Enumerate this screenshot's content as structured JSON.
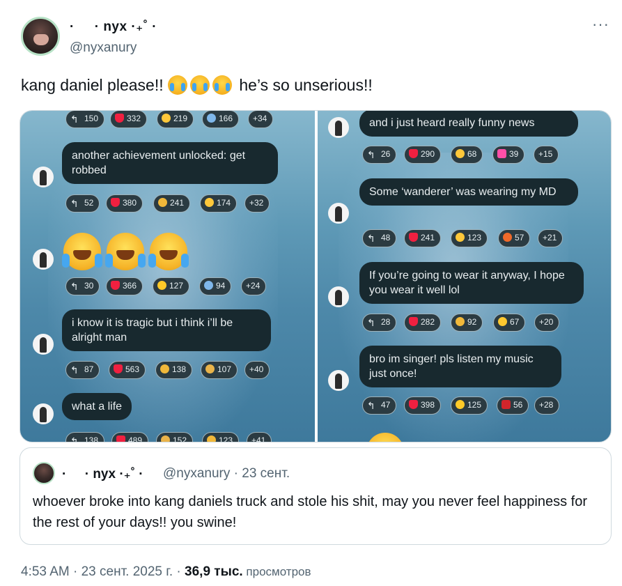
{
  "author": {
    "display_name": "·     · nyx ·₊˚ ·",
    "handle": "@nyxanury"
  },
  "tweet": {
    "text_before": "kang daniel please!! ",
    "text_after": " he’s so unserious!!",
    "emoji_name": "loudly-crying-face"
  },
  "media": {
    "left": {
      "messages": [
        {
          "text": "another achievement unlocked: get robbed"
        },
        {
          "text": "i know it is tragic but i think i’ll be alright man"
        },
        {
          "text": "what a life"
        }
      ],
      "reaction_rows": [
        [
          "150",
          "332",
          "219",
          "166",
          "+34"
        ],
        [
          "52",
          "380",
          "241",
          "174",
          "+32"
        ],
        [
          "30",
          "366",
          "127",
          "94",
          "+24"
        ],
        [
          "87",
          "563",
          "138",
          "107",
          "+40"
        ],
        [
          "138",
          "489",
          "152",
          "123",
          "+41"
        ]
      ]
    },
    "right": {
      "messages": [
        {
          "text": "and i just heard really funny news"
        },
        {
          "text": "Some ‘wanderer’ was wearing my MD"
        },
        {
          "text": "If you’re going to wear it anyway, I hope you wear it well lol"
        },
        {
          "text": "bro im singer! pls listen my music just once!"
        }
      ],
      "reaction_rows": [
        [
          "26",
          "290",
          "68",
          "39",
          "+15"
        ],
        [
          "48",
          "241",
          "123",
          "57",
          "+21"
        ],
        [
          "28",
          "282",
          "92",
          "67",
          "+20"
        ],
        [
          "47",
          "398",
          "125",
          "56",
          "+28"
        ]
      ]
    }
  },
  "quote": {
    "display_name": "·     · nyx ·₊˚ ·",
    "meta": "@nyxanury · 23 сент.",
    "text": "whoever broke into kang daniels truck and stole his shit, may you never feel happiness for the rest of your days!! you swine!"
  },
  "footer": {
    "time_date": "4:53 AM · 23 сент. 2025 г. · ",
    "views_count": "36,9 тыс.",
    "views_label": " просмотров"
  },
  "icons": {
    "reply": "reply-arrow-icon",
    "heart": "heart-icon",
    "more": "more-dots-icon"
  }
}
